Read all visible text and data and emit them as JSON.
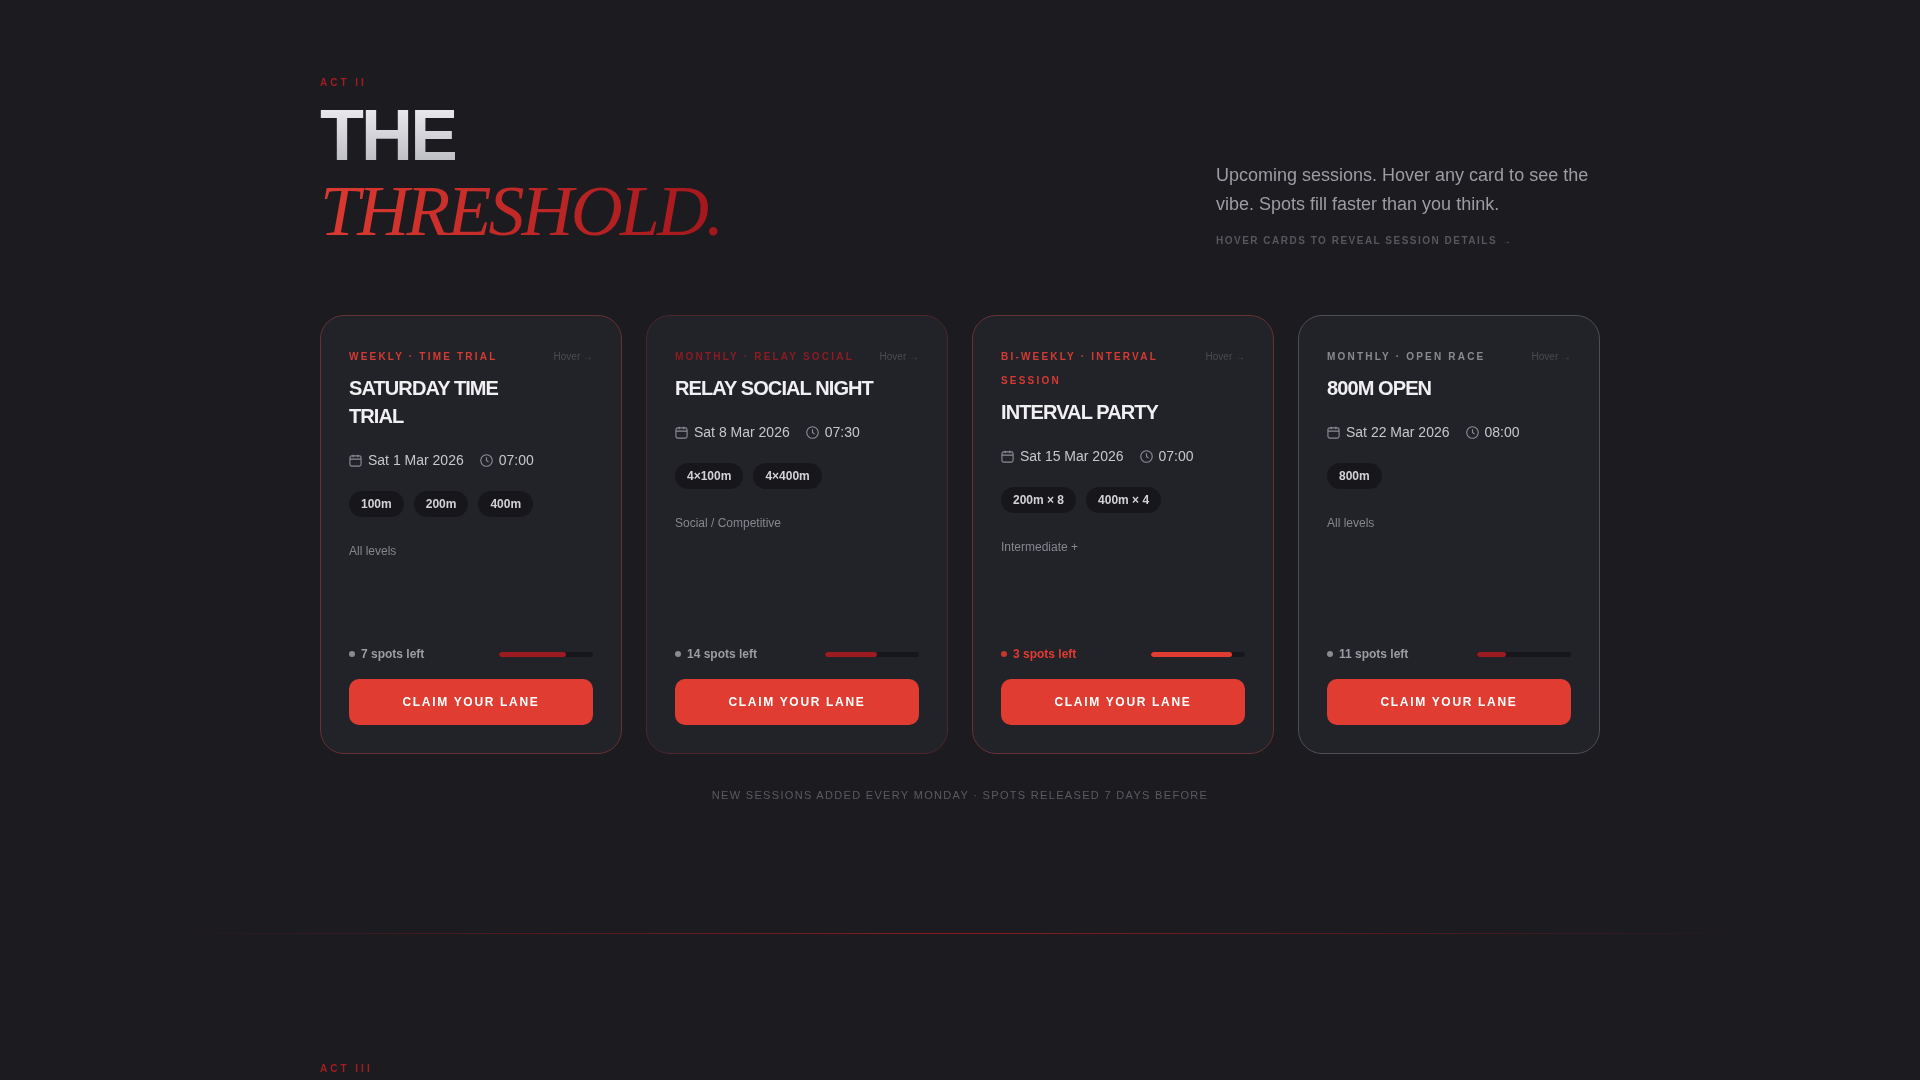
{
  "section": {
    "eyebrow": "ACT II",
    "title_line_1": "THE",
    "title_line_2": "THRESHOLD.",
    "description": "Upcoming sessions. Hover any card to see the vibe. Spots fill faster than you think.",
    "hint": "HOVER CARDS TO REVEAL SESSION DETAILS →"
  },
  "cards": [
    {
      "category": "WEEKLY · TIME TRIAL",
      "color": "#d63b33",
      "hover_hint": "Hover →",
      "title": "SATURDAY TIME TRIAL",
      "date": "Sat 1 Mar 2026",
      "time": "07:00",
      "distances": [
        "100m",
        "200m",
        "400m"
      ],
      "audience": "All levels",
      "spots": "7 spots left",
      "urgent": false,
      "level": 0.71,
      "button": "CLAIM YOUR LANE"
    },
    {
      "category": "MONTHLY · RELAY SOCIAL",
      "color": "#8c1c21",
      "hover_hint": "Hover →",
      "title": "RELAY SOCIAL NIGHT",
      "date": "Sat 8 Mar 2026",
      "time": "07:30",
      "distances": [
        "4×100m",
        "4×400m"
      ],
      "audience": "Social / Competitive",
      "spots": "14 spots left",
      "urgent": false,
      "level": 0.55,
      "button": "CLAIM YOUR LANE"
    },
    {
      "category": "BI-WEEKLY · INTERVAL SESSION",
      "color": "#d63b33",
      "hover_hint": "Hover →",
      "title": "INTERVAL PARTY",
      "date": "Sat 15 Mar 2026",
      "time": "07:00",
      "distances": [
        "200m × 8",
        "400m × 4"
      ],
      "audience": "Intermediate +",
      "spots": "3 spots left",
      "urgent": true,
      "level": 0.86,
      "button": "CLAIM YOUR LANE"
    },
    {
      "category": "MONTHLY · OPEN RACE",
      "color": "#8a8a90",
      "hover_hint": "Hover →",
      "title": "800M OPEN",
      "date": "Sat 22 Mar 2026",
      "time": "08:00",
      "distances": [
        "800m"
      ],
      "audience": "All levels",
      "spots": "11 spots left",
      "urgent": false,
      "level": 0.31,
      "button": "CLAIM YOUR LANE"
    }
  ],
  "footer_note": "NEW SESSIONS ADDED EVERY MONDAY · SPOTS RELEASED 7 DAYS BEFORE",
  "next_section": {
    "eyebrow": "ACT III"
  }
}
